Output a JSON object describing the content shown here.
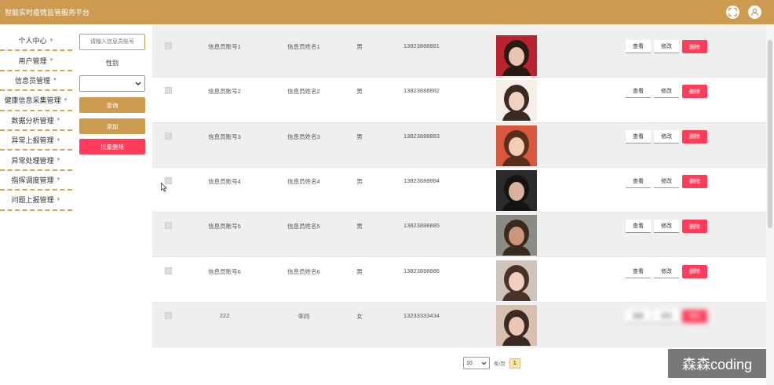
{
  "app": {
    "title": "智能实时疫情监管服务平台"
  },
  "header": {
    "icons": [
      "fullscreen-icon",
      "user-icon"
    ]
  },
  "sidebar": {
    "items": [
      {
        "label": "个人中心"
      },
      {
        "label": "用户管理"
      },
      {
        "label": "信息员管理"
      },
      {
        "label": "健康信息采集管理"
      },
      {
        "label": "数据分析管理"
      },
      {
        "label": "异常上报管理"
      },
      {
        "label": "异常处理管理"
      },
      {
        "label": "指挥调度管理"
      },
      {
        "label": "问题上报管理"
      }
    ]
  },
  "filter": {
    "search_placeholder": "请输入信息员账号",
    "gender_label": "性别",
    "gender_value": "",
    "query_label": "查询",
    "add_label": "添加",
    "batch_delete_label": "批量删除"
  },
  "table": {
    "rows": [
      {
        "account": "信息员账号1",
        "name": "信息员姓名1",
        "gender": "男",
        "phone": "13823888881",
        "view": "查看",
        "edit": "修改",
        "delete": "删除"
      },
      {
        "account": "信息员账号2",
        "name": "信息员姓名2",
        "gender": "男",
        "phone": "13823888882",
        "view": "查看",
        "edit": "修改",
        "delete": "删除"
      },
      {
        "account": "信息员账号3",
        "name": "信息员姓名3",
        "gender": "男",
        "phone": "13823888883",
        "view": "查看",
        "edit": "修改",
        "delete": "删除"
      },
      {
        "account": "信息员账号4",
        "name": "信息员姓名4",
        "gender": "男",
        "phone": "13823888884",
        "view": "查看",
        "edit": "修改",
        "delete": "删除"
      },
      {
        "account": "信息员账号5",
        "name": "信息员姓名5",
        "gender": "男",
        "phone": "13823888885",
        "view": "查看",
        "edit": "修改",
        "delete": "删除"
      },
      {
        "account": "信息员账号6",
        "name": "信息员姓名6",
        "gender": "男",
        "phone": "13823888886",
        "view": "查看",
        "edit": "修改",
        "delete": "删除"
      },
      {
        "account": "222",
        "name": "李四",
        "gender": "女",
        "phone": "13233333434",
        "view": "查看",
        "edit": "修改",
        "delete": "删除"
      }
    ]
  },
  "pagination": {
    "page_size": "10",
    "per_page_label": "条/页",
    "current_page": "1"
  },
  "watermark": {
    "text": "森森coding"
  },
  "colors": {
    "accent": "#cd9b4f",
    "danger": "#ff3d5b"
  }
}
